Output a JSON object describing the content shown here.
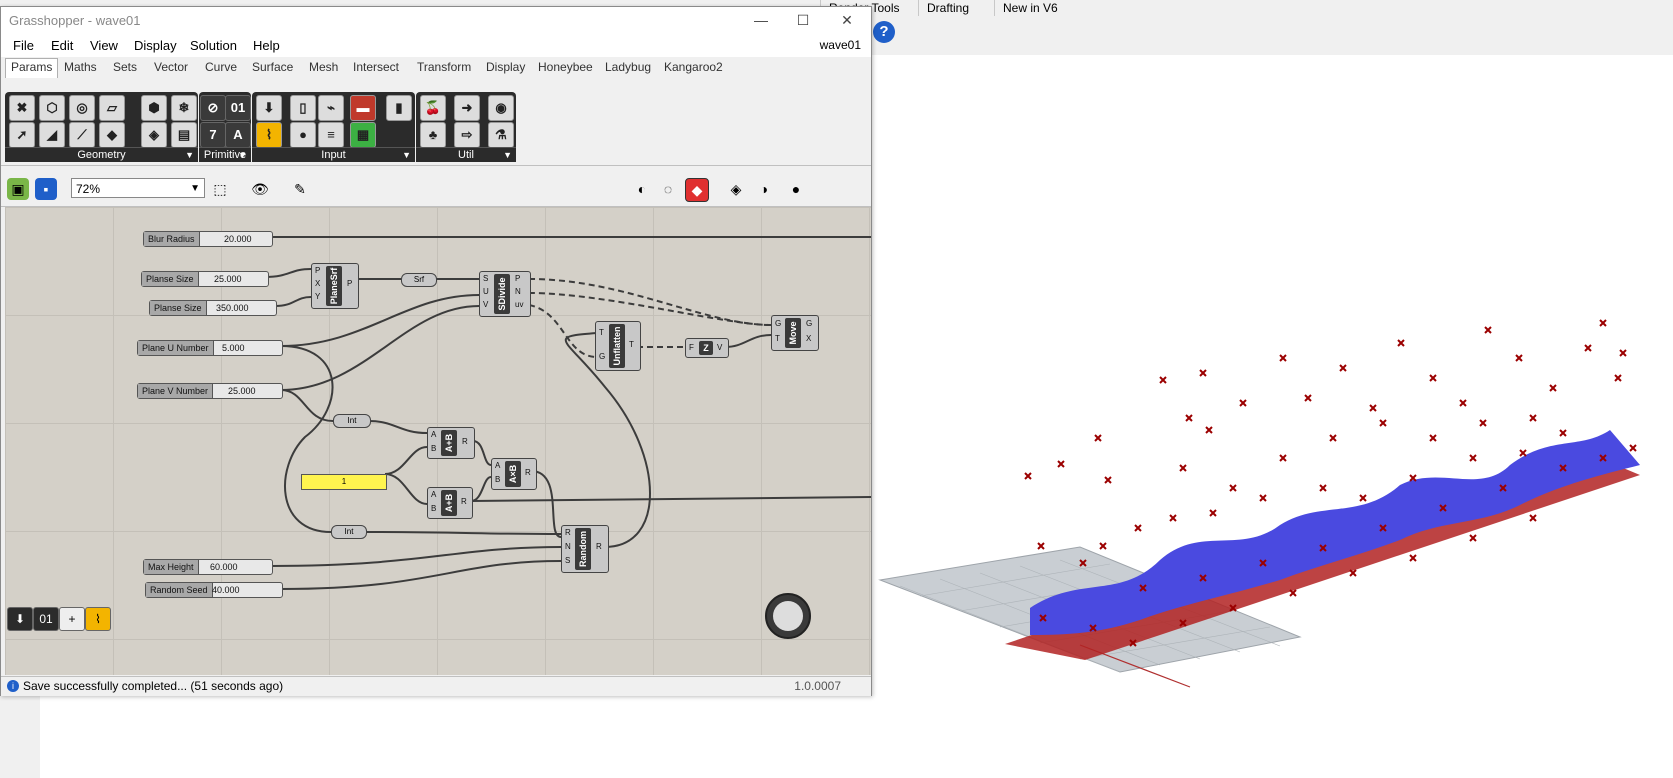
{
  "rhino": {
    "tabs": [
      "Render Tools",
      "Drafting",
      "New in V6"
    ],
    "help_icon": "?"
  },
  "gh": {
    "title": "Grasshopper - wave01",
    "window_buttons": {
      "minimize": "—",
      "maximize": "☐",
      "close": "✕"
    },
    "menu": [
      "File",
      "Edit",
      "View",
      "Display",
      "Solution",
      "Help"
    ],
    "doc_name": "wave01",
    "tabs": [
      "Params",
      "Maths",
      "Sets",
      "Vector",
      "Curve",
      "Surface",
      "Mesh",
      "Intersect",
      "Transform",
      "Display",
      "Honeybee",
      "Ladybug",
      "Kangaroo2"
    ],
    "ribbon_groups": [
      "Geometry",
      "Primitive",
      "Input",
      "Util"
    ],
    "zoom": "72%",
    "status": {
      "message": "Save successfully completed... (51 seconds ago)",
      "version": "1.0.0007"
    },
    "canvas": {
      "sliders": [
        {
          "name": "Blur Radius",
          "value": "20.000"
        },
        {
          "name": "Planse Size",
          "value": "25.000"
        },
        {
          "name": "Planse Size",
          "value": "350.000"
        },
        {
          "name": "Plane U Number",
          "value": "5.000"
        },
        {
          "name": "Plane V Number",
          "value": "25.000"
        },
        {
          "name": "Max Height",
          "value": "60.000"
        },
        {
          "name": "Random Seed",
          "value": "40.000"
        }
      ],
      "components": {
        "planesrf": "PlaneSrf",
        "sdivide": "SDivide",
        "unflatten": "Unflatten",
        "z": "Z",
        "move": "Move",
        "add1": "A+B",
        "add2": "A+B",
        "mult": "A×B",
        "random": "Random"
      },
      "params": {
        "srf": "Srf",
        "int1": "Int",
        "int2": "Int",
        "panel_value": "1"
      },
      "pins": {
        "planesrf_in": [
          "P",
          "X",
          "Y"
        ],
        "planesrf_out": "P",
        "sdivide_in": [
          "S",
          "U",
          "V"
        ],
        "sdivide_out": [
          "P",
          "N",
          "uv"
        ],
        "unflatten_in": [
          "T",
          "G"
        ],
        "unflatten_out": "T",
        "z_in": "F",
        "z_out": "V",
        "move_in": [
          "G",
          "T"
        ],
        "move_out": [
          "G",
          "X"
        ],
        "add_in": [
          "A",
          "B"
        ],
        "add_out": "R",
        "random_in": [
          "R",
          "N",
          "S"
        ],
        "random_out": "R"
      }
    }
  }
}
